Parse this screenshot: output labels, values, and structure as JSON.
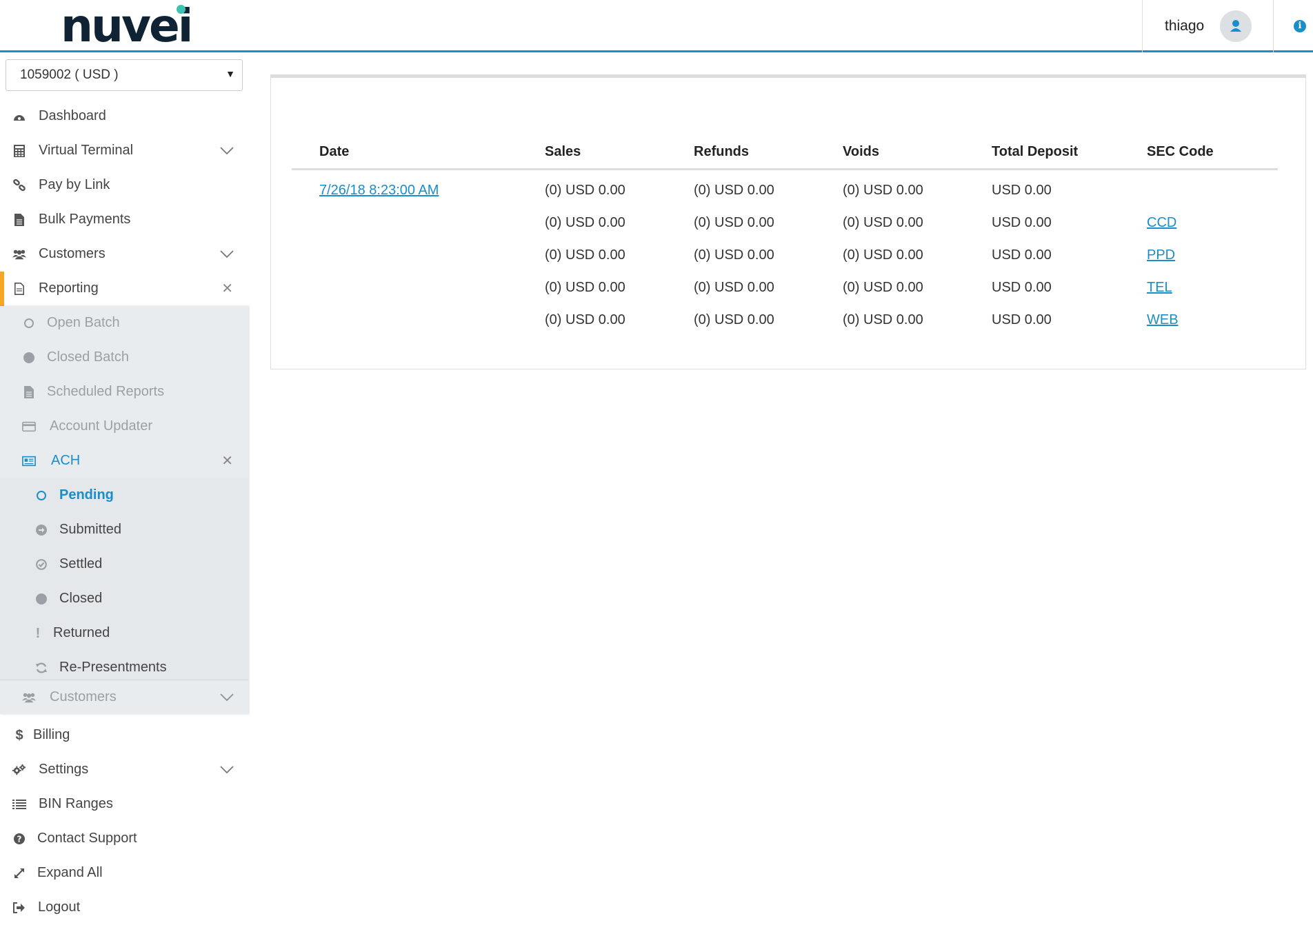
{
  "brand": {
    "logo_text": "nuvei"
  },
  "header": {
    "username": "thiago"
  },
  "sidebar": {
    "account": "1059002 ( USD )",
    "items": [
      {
        "label": "Dashboard"
      },
      {
        "label": "Virtual Terminal"
      },
      {
        "label": "Pay by Link"
      },
      {
        "label": "Bulk Payments"
      },
      {
        "label": "Customers"
      },
      {
        "label": "Reporting"
      }
    ],
    "reporting_sub": [
      {
        "label": "Open Batch"
      },
      {
        "label": "Closed Batch"
      },
      {
        "label": "Scheduled Reports"
      },
      {
        "label": "Account Updater"
      },
      {
        "label": "ACH"
      }
    ],
    "ach_sub": [
      {
        "label": "Pending"
      },
      {
        "label": "Submitted"
      },
      {
        "label": "Settled"
      },
      {
        "label": "Closed"
      },
      {
        "label": "Returned"
      },
      {
        "label": "Re-Presentments"
      }
    ],
    "reporting_customers": "Customers",
    "bottom_items": [
      {
        "label": "Billing"
      },
      {
        "label": "Settings"
      },
      {
        "label": "BIN Ranges"
      },
      {
        "label": "Contact Support"
      },
      {
        "label": "Expand All"
      },
      {
        "label": "Logout"
      }
    ]
  },
  "table": {
    "headers": [
      "Date",
      "Sales",
      "Refunds",
      "Voids",
      "Total Deposit",
      "SEC Code"
    ],
    "rows": [
      {
        "date": "7/26/18 8:23:00 AM",
        "sales": "(0) USD 0.00",
        "refunds": "(0) USD 0.00",
        "voids": "(0) USD 0.00",
        "total": "USD 0.00",
        "sec": ""
      },
      {
        "date": "",
        "sales": "(0) USD 0.00",
        "refunds": "(0) USD 0.00",
        "voids": "(0) USD 0.00",
        "total": "USD 0.00",
        "sec": "CCD"
      },
      {
        "date": "",
        "sales": "(0) USD 0.00",
        "refunds": "(0) USD 0.00",
        "voids": "(0) USD 0.00",
        "total": "USD 0.00",
        "sec": "PPD"
      },
      {
        "date": "",
        "sales": "(0) USD 0.00",
        "refunds": "(0) USD 0.00",
        "voids": "(0) USD 0.00",
        "total": "USD 0.00",
        "sec": "TEL"
      },
      {
        "date": "",
        "sales": "(0) USD 0.00",
        "refunds": "(0) USD 0.00",
        "voids": "(0) USD 0.00",
        "total": "USD 0.00",
        "sec": "WEB"
      }
    ]
  },
  "colors": {
    "accent": "#1a8dcc",
    "active_marker": "#f5a623",
    "brand_dark": "#0f2334",
    "brand_dot": "#3cc3b0"
  }
}
